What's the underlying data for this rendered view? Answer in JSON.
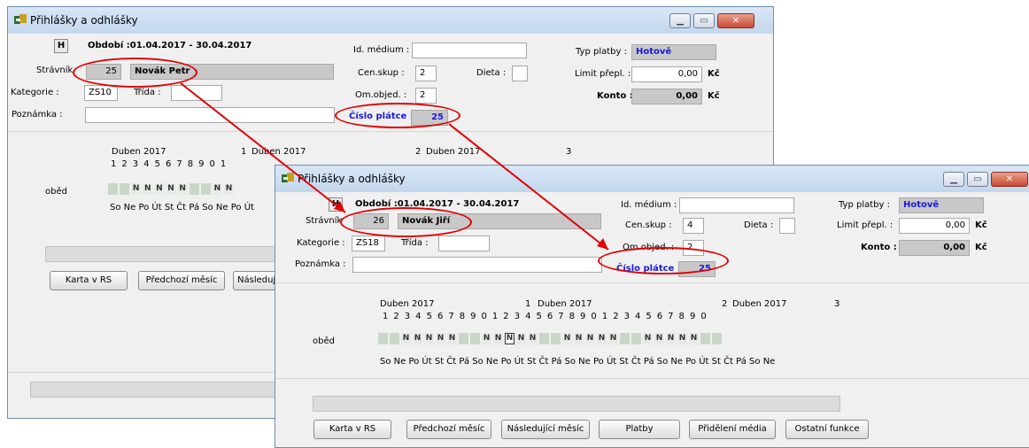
{
  "title": "Přihlášky a odhlášky",
  "labels": {
    "h": "H",
    "obdobi": "Období :01.04.2017 - 30.04.2017",
    "stravnik": "Strávník",
    "kategorie": "Kategorie :",
    "trida": "Třída :",
    "poznamka": "Poznámka :",
    "id_medium": "Id. médium :",
    "cen_skup": "Cen.skup :",
    "dieta": "Dieta :",
    "om_objed": "Om.objed. :",
    "cislo_platce": "Číslo plátce :",
    "typ_platby": "Typ platby :",
    "limit": "Limit přepl. :",
    "konto": "Konto :",
    "kc": "Kč",
    "obed": "oběd",
    "month": "Duben 2017",
    "digit1": "1",
    "digit2": "2",
    "digit3": "3"
  },
  "back": {
    "stravnik_cislo": "25",
    "stravnik_jmeno": "Novák Petr",
    "kategorie": "ZS10",
    "cen_skup": "2",
    "om_objed": "2",
    "cislo_platce": "25",
    "typ_platby": "Hotově",
    "limit": "0,00",
    "konto": "0,00",
    "cal_digits": [
      "1",
      "2",
      "3",
      "4",
      "5",
      "6",
      "7",
      "8",
      "9",
      "0",
      "1"
    ],
    "cal_days": "So Ne Po Út St Čt Pá So Ne Po Út",
    "btn_karta": "Karta v RS",
    "btn_predchozi": "Předchozí měsíc",
    "btn_nasl": "Následujíc"
  },
  "front": {
    "stravnik_cislo": "26",
    "stravnik_jmeno": "Novák Jiří",
    "kategorie": "ZS18",
    "cen_skup": "4",
    "om_objed": "2",
    "cislo_platce": "25",
    "typ_platby": "Hotově",
    "limit": "0,00",
    "konto": "0,00",
    "cal_digits": [
      "1",
      "2",
      "3",
      "4",
      "5",
      "6",
      "7",
      "8",
      "9",
      "0",
      "1",
      "2",
      "3",
      "4",
      "5",
      "6",
      "7",
      "8",
      "9",
      "0",
      "1",
      "2",
      "3",
      "4",
      "5",
      "6",
      "7",
      "8",
      "9",
      "0"
    ],
    "cal_days": "So Ne Po Út St Čt Pá So Ne Po Út St Čt Pá So Ne Po Út St Čt Pá So Ne Po Út St Čt Pá So Ne",
    "btn_karta": "Karta v RS",
    "btn_predchozi": "Předchozí měsíc",
    "btn_nasl": "Následující měsíc",
    "btn_platby": "Platby",
    "btn_prideleni": "Přidělení média",
    "btn_ostatni": "Ostatní funkce"
  },
  "colors": {
    "highlight": "#e00000",
    "accent_text": "#1a1adc"
  }
}
